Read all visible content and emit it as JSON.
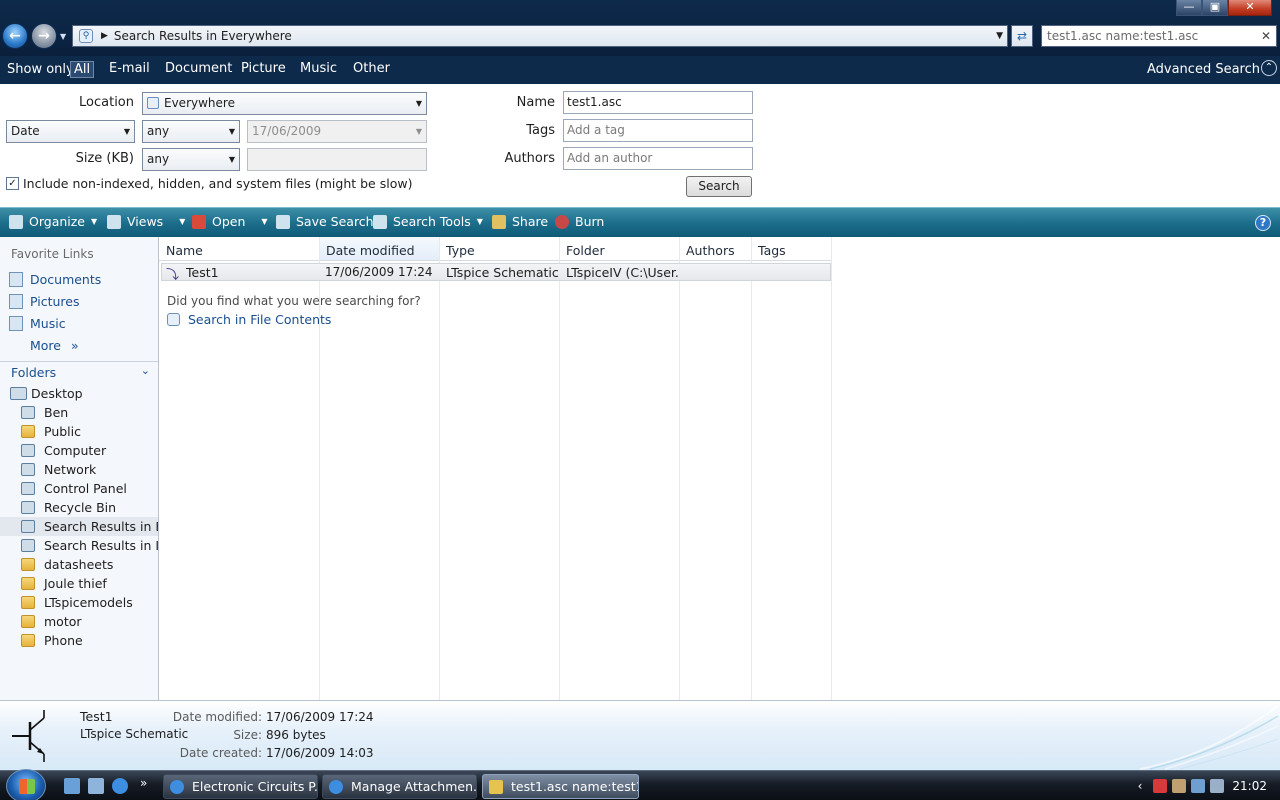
{
  "window": {
    "address": "Search Results in Everywhere",
    "search_query": "test1.asc name:test1.asc",
    "controls": {
      "minimize": "—",
      "maximize": "▣",
      "close": "✕"
    }
  },
  "show_only": {
    "label": "Show only:",
    "filters": [
      "All",
      "E-mail",
      "Document",
      "Picture",
      "Music",
      "Other"
    ],
    "selected": "All",
    "advanced_search": "Advanced Search"
  },
  "advanced": {
    "location_label": "Location",
    "location_value": "Everywhere",
    "date_field": "Date",
    "date_op": "any",
    "date_value": "17/06/2009",
    "size_label": "Size (KB)",
    "size_op": "any",
    "size_value": "",
    "name_label": "Name",
    "name_value": "test1.asc",
    "tags_label": "Tags",
    "tags_placeholder": "Add a tag",
    "authors_label": "Authors",
    "authors_placeholder": "Add an author",
    "include_label": "Include non-indexed, hidden, and system files (might be slow)",
    "include_checked": true,
    "search_button": "Search"
  },
  "command_bar": [
    "Organize",
    "Views",
    "Open",
    "Save Search",
    "Search Tools",
    "Share",
    "Burn"
  ],
  "nav": {
    "favorites_title": "Favorite Links",
    "favorites": [
      "Documents",
      "Pictures",
      "Music"
    ],
    "more": "More",
    "folders_title": "Folders",
    "tree": [
      {
        "label": "Desktop",
        "icon": "desktop-icon",
        "level": 0
      },
      {
        "label": "Ben",
        "icon": "user-icon",
        "level": 1
      },
      {
        "label": "Public",
        "icon": "folder-icon",
        "level": 1
      },
      {
        "label": "Computer",
        "icon": "computer-icon",
        "level": 1
      },
      {
        "label": "Network",
        "icon": "network-icon",
        "level": 1
      },
      {
        "label": "Control Panel",
        "icon": "control-panel-icon",
        "level": 1
      },
      {
        "label": "Recycle Bin",
        "icon": "recycle-bin-icon",
        "level": 1
      },
      {
        "label": "Search Results in Ever",
        "icon": "search-folder-icon",
        "level": 1,
        "selected": true
      },
      {
        "label": "Search Results in Inde",
        "icon": "search-folder-icon",
        "level": 1
      },
      {
        "label": "datasheets",
        "icon": "folder-icon",
        "level": 1
      },
      {
        "label": "Joule thief",
        "icon": "folder-icon",
        "level": 1
      },
      {
        "label": "LTspicemodels",
        "icon": "folder-icon",
        "level": 1
      },
      {
        "label": "motor",
        "icon": "folder-icon",
        "level": 1
      },
      {
        "label": "Phone",
        "icon": "folder-icon",
        "level": 1
      }
    ]
  },
  "file_list": {
    "columns": [
      "Name",
      "Date modified",
      "Type",
      "Folder",
      "Authors",
      "Tags"
    ],
    "sorted_column": "Date modified",
    "rows": [
      {
        "name": "Test1",
        "date_modified": "17/06/2009 17:24",
        "type": "LTspice Schematic",
        "folder": "LTspiceIV (C:\\User...",
        "authors": "",
        "tags": ""
      }
    ],
    "prompt": "Did you find what you were searching for?",
    "search_contents": "Search in File Contents"
  },
  "details": {
    "name": "Test1",
    "type": "LTspice Schematic",
    "date_modified_label": "Date modified:",
    "date_modified": "17/06/2009 17:24",
    "size_label": "Size:",
    "size": "896 bytes",
    "date_created_label": "Date created:",
    "date_created": "17/06/2009 14:03"
  },
  "taskbar": {
    "buttons": [
      {
        "label": "Electronic Circuits P...",
        "icon": "ie-icon",
        "active": false
      },
      {
        "label": "Manage Attachmen...",
        "icon": "ie-icon",
        "active": false
      },
      {
        "label": "test1.asc name:test1...",
        "icon": "search-folder-icon",
        "active": true
      }
    ],
    "clock": "21:02"
  }
}
